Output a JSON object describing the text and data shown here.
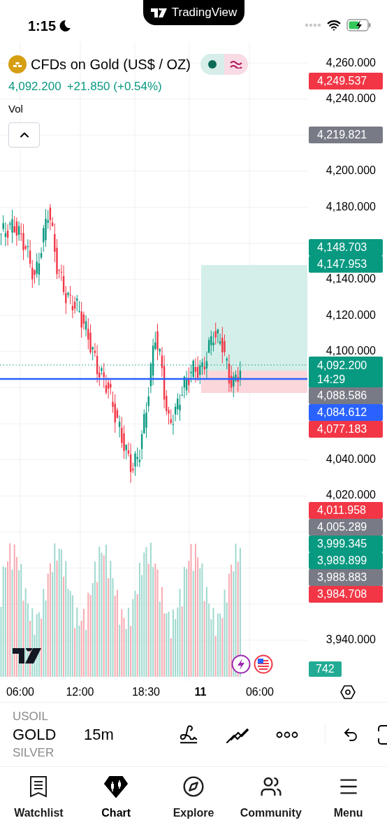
{
  "status_bar": {
    "time": "1:15",
    "island_label": "TradingView"
  },
  "symbol": {
    "name": "CFDs on Gold (US$ / OZ)",
    "price": "4,092.200",
    "change": "+21.850 (+0.54%)",
    "indicator": "Vol"
  },
  "price_axis": [
    "4,260.000",
    "4,240.000",
    "4,200.000",
    "4,180.000",
    "4,140.000",
    "4,120.000",
    "4,100.000",
    "4,040.000",
    "4,020.000",
    "3,940.000"
  ],
  "price_labels": [
    {
      "text": "4,249.537",
      "color": "#f23645"
    },
    {
      "text": "4,219.821",
      "color": "#787b86"
    },
    {
      "text": "4,148.703",
      "color": "#089981"
    },
    {
      "text": "4,147.953",
      "color": "#089981"
    },
    {
      "text": "4,092.200",
      "subtext": "14:29",
      "color": "#089981"
    },
    {
      "text": "4,088.586",
      "color": "#787b86"
    },
    {
      "text": "4,084.612",
      "color": "#2962ff"
    },
    {
      "text": "4,077.183",
      "color": "#f23645"
    },
    {
      "text": "4,011.958",
      "color": "#f23645"
    },
    {
      "text": "4,005.289",
      "color": "#787b86"
    },
    {
      "text": "3,999.345",
      "color": "#089981"
    },
    {
      "text": "3,989.899",
      "color": "#089981"
    },
    {
      "text": "3,988.883",
      "color": "#787b86"
    },
    {
      "text": "3,984.708",
      "color": "#f23645"
    }
  ],
  "volume_label": "742",
  "time_axis": [
    {
      "label": "06:00",
      "bold": false
    },
    {
      "label": "12:00",
      "bold": false
    },
    {
      "label": "18:30",
      "bold": false
    },
    {
      "label": "11",
      "bold": true
    },
    {
      "label": "06:00",
      "bold": false
    }
  ],
  "toolbar": {
    "symbols": [
      {
        "label": "USOIL",
        "selected": false
      },
      {
        "label": "GOLD",
        "selected": true
      },
      {
        "label": "SILVER",
        "selected": false
      }
    ],
    "interval": "15m"
  },
  "nav": [
    {
      "label": "Watchlist",
      "selected": false
    },
    {
      "label": "Chart",
      "selected": true
    },
    {
      "label": "Explore",
      "selected": false
    },
    {
      "label": "Community",
      "selected": false
    },
    {
      "label": "Menu",
      "selected": false
    }
  ]
}
